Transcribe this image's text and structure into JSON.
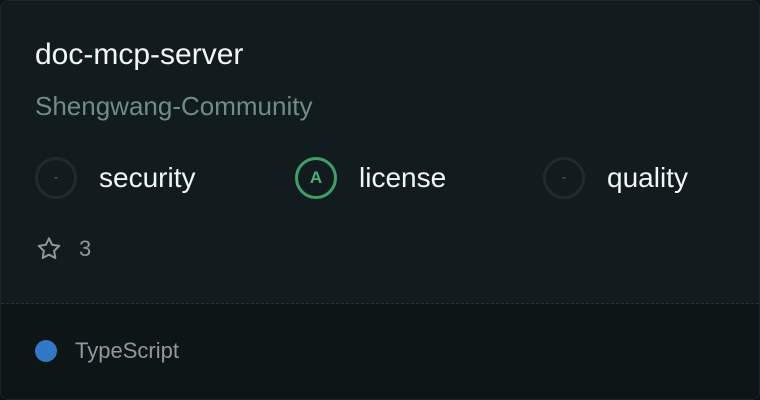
{
  "repo": {
    "name": "doc-mcp-server",
    "owner": "Shengwang-Community"
  },
  "metrics": [
    {
      "label": "security",
      "grade": "-"
    },
    {
      "label": "license",
      "grade": "A"
    },
    {
      "label": "quality",
      "grade": "-"
    }
  ],
  "stars": {
    "icon": "star-icon",
    "count": "3"
  },
  "language": {
    "name": "TypeScript",
    "color": "#3178c6"
  },
  "colors": {
    "grade_good": "#48b276",
    "grade_none": "#4a5458"
  }
}
